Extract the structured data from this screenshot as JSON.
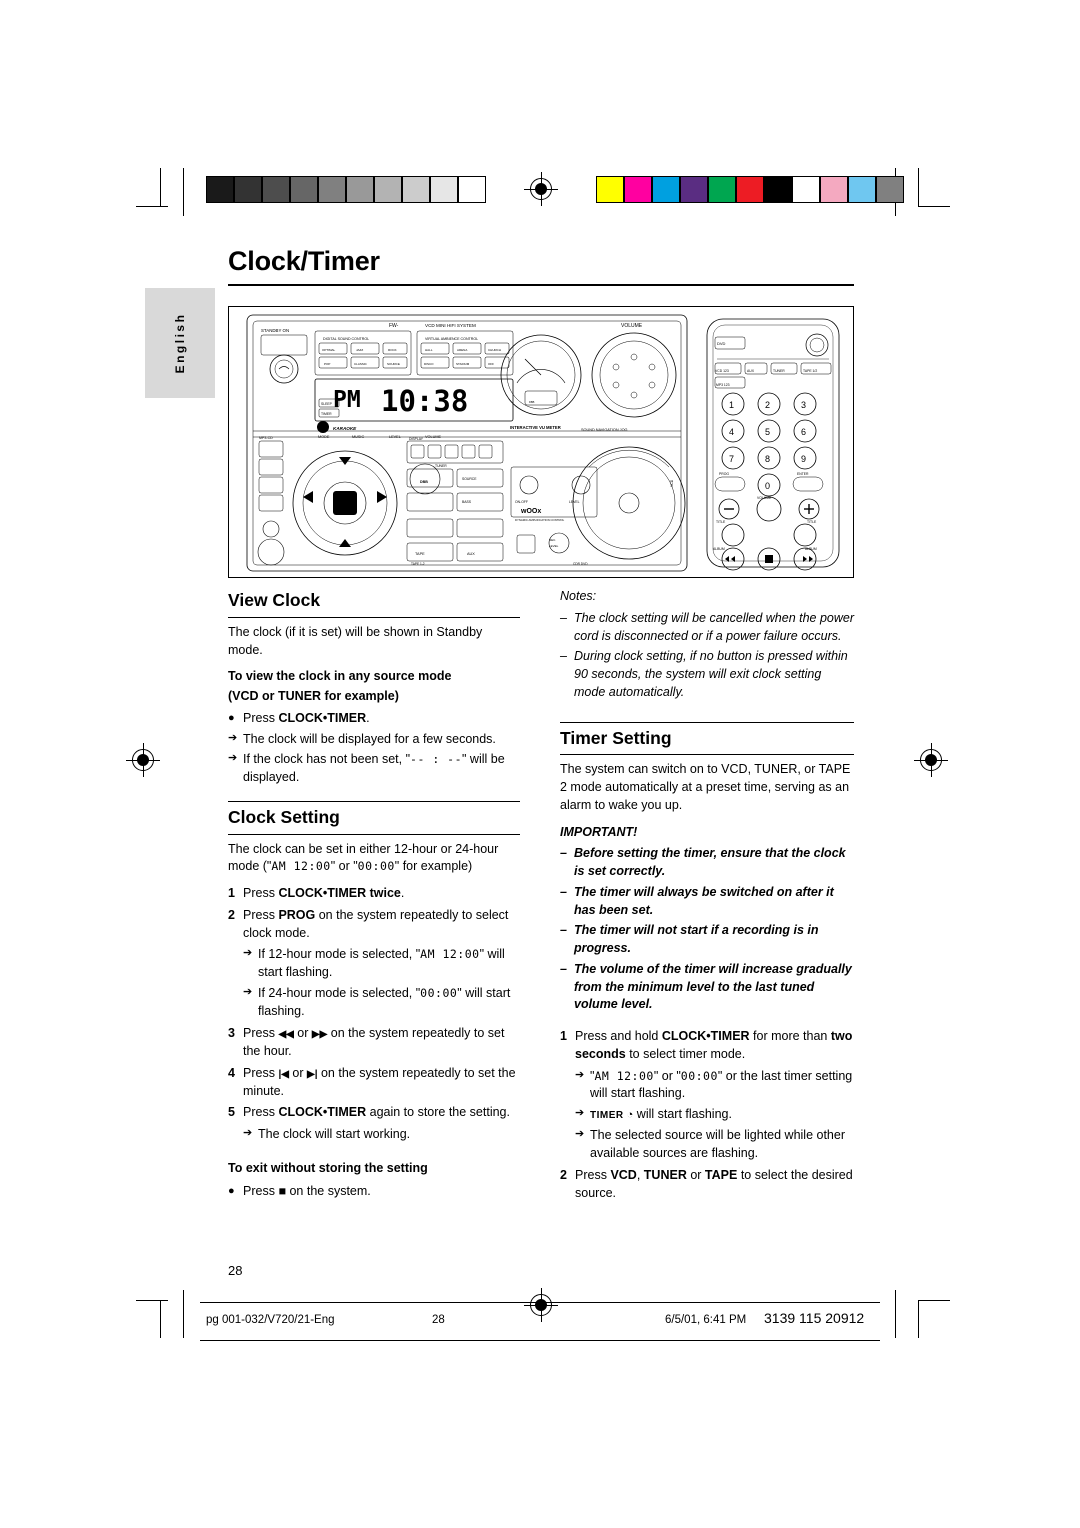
{
  "page": {
    "title": "Clock/Timer",
    "language_tab": "English",
    "page_number": "28"
  },
  "figure": {
    "brand": "FW-",
    "model_line": "VCD MINI HIFI SYSTEM",
    "standby_label": "STANDBY ON",
    "volume_label": "VOLUME",
    "digital_sound_control": "DIGITAL SOUND CONTROL",
    "virtual_ambience_control": "VIRTUAL AMBIENCE CONTROL",
    "dsc_buttons": [
      "OPTIMAL",
      "JAZZ",
      "ROCK",
      "POP",
      "CLASSIC",
      "HALL",
      "ARENA",
      "CHURCH",
      "DISCO"
    ],
    "display_time": "10:38",
    "display_ampm": "PM",
    "sleep_label": "SLEEP",
    "timer_label": "TIMER",
    "mode_label": "MODE",
    "karaoke_label": "KARAOKE",
    "music_label": "MUSIC",
    "level_label": "LEVEL",
    "volume_small_label": "VOLUME",
    "interactive_vu_meter": "INTERACTIVE VU METER",
    "sound_navigation_jog": "SOUND NAVIGATION JOG",
    "mp3_cd_label": "MP3-CD",
    "display_small": "DISPLAY",
    "tuner_label": "TUNER",
    "source_label": "SOURCE",
    "tape_label": "TAPE",
    "aux_label": "AUX",
    "dbb_label": "DBB",
    "bass_label": "BASS",
    "woox_label": "wOOx",
    "woox_sub": "DYNAMIC AMPLIFICATION CONTROL",
    "on_off_label": "ON-OFF",
    "level_label2": "LEVEL",
    "rec_level_label": "REC. LEVEL",
    "tape12_label": "TAPE 1-2",
    "cdr_dvd_label": "CDR DVD",
    "jog_label": "JOG",
    "vcd_label": "VCD",
    "remote": {
      "dvd_btn": "DVD",
      "source_row": [
        "VCD 123",
        "AUX",
        "TUNER",
        "TAPE 1/2"
      ],
      "mp3_label": "MP3 123",
      "keys": [
        "1",
        "2",
        "3",
        "4",
        "5",
        "6",
        "7",
        "8",
        "9",
        "0"
      ],
      "prog_label": "PROG",
      "enter_label": "ENTER",
      "volume_label": "VOLUME",
      "title_left": "TITLE",
      "title_right": "TITLE",
      "album_left": "ALBUM",
      "album_right": "ALBUM"
    }
  },
  "view_clock": {
    "heading": "View Clock",
    "intro": "The clock (if it is set) will be shown in Standby mode.",
    "sub_head_1": "To view the clock in any source mode",
    "sub_head_2": "(VCD or TUNER for example)",
    "bullet_press_prefix": "Press ",
    "bullet_press_bold": "CLOCK•TIMER",
    "bullet_press_suffix": ".",
    "arrow_1": "The clock will be displayed for a few seconds.",
    "arrow_2_prefix": "If the clock has not been set, \"",
    "arrow_2_lcd": "-- : --",
    "arrow_2_suffix": "\" will be displayed."
  },
  "clock_setting": {
    "heading": "Clock Setting",
    "intro_a": "The clock can be set in either 12-hour or 24-hour mode (\"",
    "intro_lcd_1": "AM  12:00",
    "intro_b": "\" or \"",
    "intro_lcd_2": "00:00",
    "intro_c": "\" for example)",
    "steps": [
      {
        "num": "1",
        "text_prefix": "Press ",
        "bold": "CLOCK•TIMER twice",
        "text_suffix": "."
      },
      {
        "num": "2",
        "text_prefix": "Press ",
        "bold": "PROG",
        "text_suffix": " on the system repeatedly to select clock mode."
      },
      {
        "num": "3",
        "text_prefix": "Press ",
        "bold": "",
        "text_suffix": " on the system repeatedly to set the hour."
      },
      {
        "num": "4",
        "text_prefix": "Press ",
        "bold": "",
        "text_suffix": " on the system repeatedly to set the minute."
      },
      {
        "num": "5",
        "text_prefix": "Press ",
        "bold": "CLOCK•TIMER",
        "text_suffix": " again to store the setting."
      }
    ],
    "step2_arrow_1_a": "If 12-hour mode is selected, \"",
    "step2_arrow_1_lcd": "AM  12:00",
    "step2_arrow_1_b": "\" will start flashing.",
    "step2_arrow_2_a": "If 24-hour mode is selected, \"",
    "step2_arrow_2_lcd": "00:00",
    "step2_arrow_2_b": "\" will start flashing.",
    "step3_btn_a": "◀◀",
    "step3_or": " or ",
    "step3_btn_b": "▶▶",
    "step4_btn_a": "|◀",
    "step4_or": " or ",
    "step4_btn_b": "▶|",
    "step5_arrow": "The clock will start working.",
    "exit_head": "To exit without storing the setting",
    "exit_bullet_prefix": "Press ",
    "exit_bullet_suffix": " on the system."
  },
  "notes": {
    "label": "Notes:",
    "items": [
      "The clock setting will be cancelled when the power cord is disconnected or if a power failure occurs.",
      "During clock setting, if no button is pressed within 90 seconds, the system will exit clock setting mode automatically."
    ]
  },
  "timer_setting": {
    "heading": "Timer Setting",
    "intro": "The system can switch on to VCD, TUNER, or TAPE 2 mode automatically at a preset time, serving as an alarm to wake you up.",
    "important_label": "IMPORTANT!",
    "important_items": [
      "Before setting the timer, ensure that the clock is set correctly.",
      "The timer will always be switched on after it has been set.",
      "The timer will not start if a recording is in progress.",
      "The volume of the timer will increase gradually from the minimum level to the last tuned volume level."
    ],
    "steps": [
      {
        "num": "1",
        "prefix": "Press and hold ",
        "bold": "CLOCK•TIMER",
        "mid": " for more than ",
        "bold2": "two seconds",
        "suffix": " to select timer mode."
      },
      {
        "num": "2",
        "prefix": "Press ",
        "bold": "VCD",
        "mid": ", ",
        "bold2": "TUNER",
        "mid2": " or ",
        "bold3": "TAPE",
        "suffix": " to select the desired source."
      }
    ],
    "step1_arrow_1_a": "\"",
    "step1_arrow_1_lcd1": "AM  12:00",
    "step1_arrow_1_b": "\" or \"",
    "step1_arrow_1_lcd2": "00:00",
    "step1_arrow_1_c": "\" or the last timer setting will start flashing.",
    "step1_arrow_2_badge": "TIMER",
    "step1_arrow_2_text": " will start flashing.",
    "step1_arrow_3": "The selected source will be lighted while other available sources are flashing."
  },
  "footer": {
    "left": "pg 001-032/V720/21-Eng",
    "center": "28",
    "date": "6/5/01, 6:41 PM",
    "right": "3139 115 20912"
  },
  "colors": {
    "grays": [
      "#1a1a1a",
      "#333333",
      "#4d4d4d",
      "#666666",
      "#808080",
      "#999999",
      "#b3b3b3",
      "#cccccc",
      "#e6e6e6",
      "#ffffff"
    ],
    "swatches": [
      "#ffff00",
      "#ff00a0",
      "#00a0e0",
      "#5a2d82",
      "#00a650",
      "#ed1c24",
      "#000000",
      "#ffffff",
      "#f4a9c0",
      "#6fc7f0",
      "#808080"
    ]
  }
}
